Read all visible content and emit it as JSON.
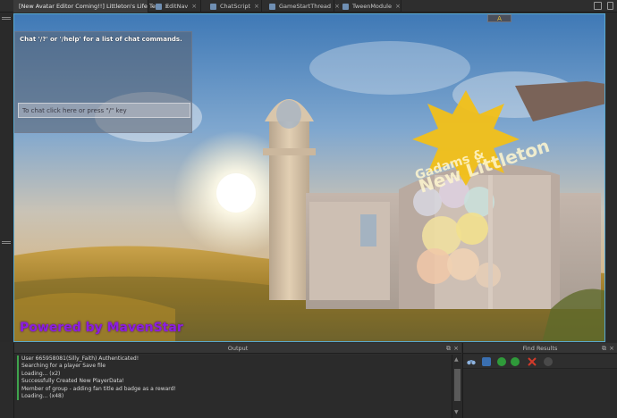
{
  "tabs": [
    {
      "label": "[New Avatar Editor Coming!!] Littleton's Life Test",
      "active": true
    },
    {
      "label": "EditNav",
      "active": false
    },
    {
      "label": "ChatScript",
      "active": false
    },
    {
      "label": "GameStartThread",
      "active": false
    },
    {
      "label": "TweenModule",
      "active": false
    }
  ],
  "tab_close_glyph": "×",
  "viewport": {
    "chat_hint": "Chat '/?' or '/help' for a list of chat commands.",
    "chat_input_placeholder": "To chat click here or press \"/\" key",
    "top_badge": "A",
    "powered_by": "Powered by MavenStar",
    "sign_text": [
      "Gadams &",
      "New Littleton"
    ]
  },
  "output": {
    "title": "Output",
    "lines": [
      "User 665958081(Silly_Faith)  Authenticated!",
      "Searching for a player Save file",
      "Loading... (x2)",
      "Successfully Created New PlayerData!",
      "Member of group - adding fan title ad badge as a reward!",
      "Loading... (x48)"
    ]
  },
  "find_results": {
    "title": "Find Results"
  },
  "colors": {
    "accent": "#58a9d0",
    "powered_text": "#8c1ee0",
    "output_marker": "#3fa34d"
  }
}
